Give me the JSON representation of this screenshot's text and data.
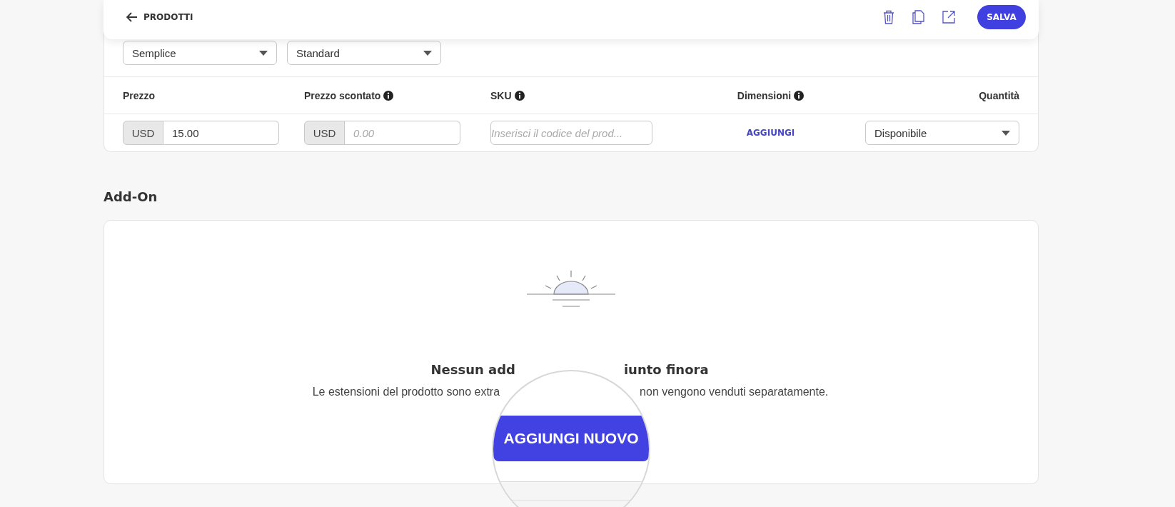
{
  "header": {
    "back_label": "PRODOTTI",
    "save_label": "SALVA"
  },
  "selects": [
    {
      "value": "Semplice"
    },
    {
      "value": "Standard"
    }
  ],
  "columns": [
    {
      "label": "Prezzo",
      "info": false
    },
    {
      "label": "Prezzo scontato",
      "info": true
    },
    {
      "label": "SKU",
      "info": true
    },
    {
      "label": "Dimensioni",
      "info": true
    },
    {
      "label": "Quantità",
      "info": false
    }
  ],
  "row": [
    {
      "kind": "currency",
      "prefix": "USD",
      "value": "15.00"
    },
    {
      "kind": "currency",
      "prefix": "USD",
      "placeholder": "0.00"
    },
    {
      "kind": "text",
      "placeholder": "Inserisci il codice del prod..."
    },
    {
      "kind": "link",
      "label": "AGGIUNGI"
    },
    {
      "kind": "select",
      "value": "Disponibile"
    }
  ],
  "addon": {
    "title": "Add-On",
    "empty_title_parts": [
      "Nessun add",
      "iunto finora"
    ],
    "description_parts": [
      "Le estensioni del prodotto sono extra",
      "non vengono venduti separatamente."
    ],
    "button_label": "AGGIUNGI NUOVO"
  }
}
